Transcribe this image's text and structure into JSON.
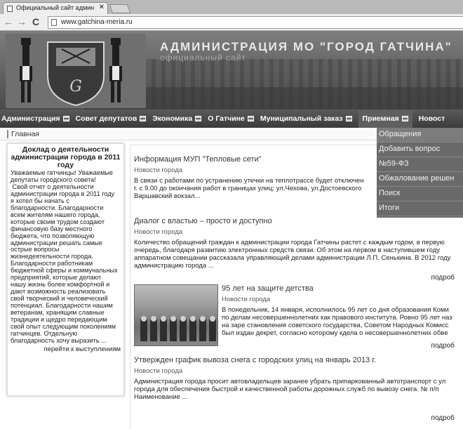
{
  "browser": {
    "tab_title": "Официальный сайт админ",
    "tab_close": "✕",
    "back": "←",
    "forward": "→",
    "reload": "C",
    "url": "www.gatchina-meria.ru"
  },
  "header": {
    "title": "АДМИНИСТРАЦИЯ МО \"ГОРОД ГАТЧИНА\"",
    "subtitle": "официальный сайт"
  },
  "menu": {
    "items": [
      {
        "label": "Администрация"
      },
      {
        "label": "Совет депутатов"
      },
      {
        "label": "Экономика"
      },
      {
        "label": "О Гатчине"
      },
      {
        "label": "Муниципальный заказ"
      },
      {
        "label": "Приемная"
      },
      {
        "label": "Новост"
      }
    ]
  },
  "breadcrumb": "Главная",
  "dropdown": {
    "items": [
      "Обращения",
      "Добавить вопрос",
      "№59-ФЗ",
      "Обжалование решен",
      "Поиск",
      "Итоги"
    ]
  },
  "report": {
    "title": "Доклад о деятельности администрации города в 2011 году",
    "lines": [
      "Уважаемые гатчинцы! Уважаемые",
      "депутаты городского совета!",
      " Свой отчет о деятельности",
      "администрации города в 2011 году",
      "я хотел бы начать с",
      "благодарности. Благодарности",
      "всем жителям нашего города,",
      "которые своим трудом создают",
      "финансовую базу местного",
      "бюджета, что позволяющую",
      "администрации решать самые",
      "острые вопросы",
      "жизнедеятельности города.",
      "Благодарности работникам",
      "бюджетной сферы и коммунальных",
      "предприятий, которые делают",
      "нашу жизнь более комфортной и",
      "дают возможность реализовать",
      "свой творческий и человеческий",
      "потенциал. Благодарности нашим",
      "ветеранам, хранящим славные",
      "традиции и щедро передающим",
      "свой опыт следующим поколениям",
      "гатчинцев. Отдельную",
      "благодарность хочу выразить ..."
    ],
    "more": "перейти к выступлениям"
  },
  "news": [
    {
      "title": "Информация МУП \"Тепловые сети\"",
      "category": "Новости города",
      "lines": [
        "В связи с работами по устранению утечки на теплотрассе будет отключен",
        "г. с 9.00 до окончания работ в границах улиц: ул.Чехова, ул.Достоевского",
        "Варшавский вокзал..."
      ]
    },
    {
      "title": "Диалог с властью – просто и доступно",
      "category": "Новости города",
      "lines": [
        "Количество обращений граждан к администрации города Гатчины растет с каждым годом, в первую",
        "очередь, благодаря развитию электронных средств связи. Об этом на первом в наступившем году",
        "аппаратном совещании рассказала управляющий делами администрации Л.П. Сенькина. В 2012 году",
        "администрацию города ..."
      ],
      "more": "подроб"
    },
    {
      "title": "95 лет на защите детства",
      "category": "Новости города",
      "lines": [
        "В понедельник, 14 января, исполнилось 95 лет со дня образования Коми",
        "по делам несовершеннолетних как правового института. Ровно 95 лет наз",
        "на заре становления советского государства, Советом Народных Комисс",
        "был издан декрет, согласно которому кдела о несовершеннолетних обвe"
      ],
      "more": "подроб"
    },
    {
      "title": "Утвержден график вывоза снега с городских улиц на январь 2013 г.",
      "category": "Новости города",
      "lines": [
        "Администрация города просит автовладельцев заранее убрать припаркованный автотранспорт с ул",
        "города для обеспечения быстрой и качественной работы дорожных служб по вывозу снега.  № п/п",
        "Наименование ..."
      ],
      "more": "подроб"
    }
  ]
}
